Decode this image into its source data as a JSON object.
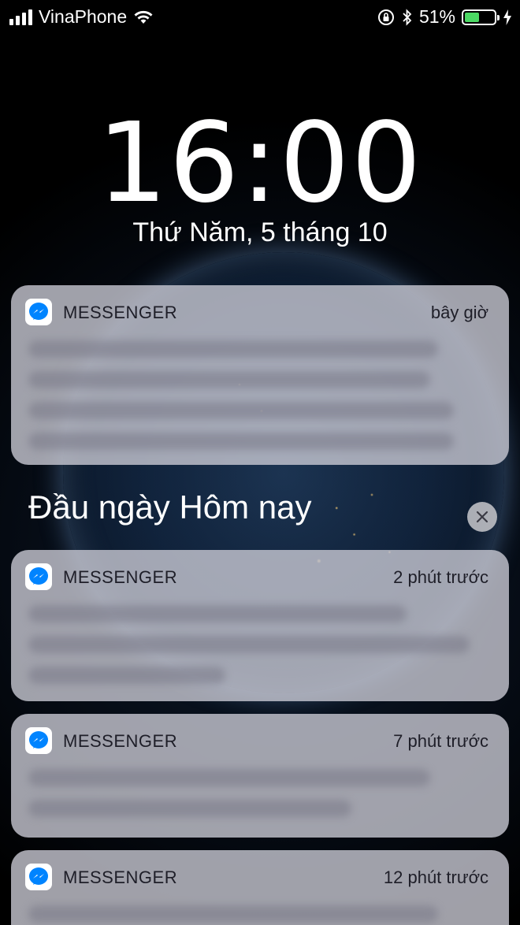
{
  "status_bar": {
    "carrier": "VinaPhone",
    "battery_percent": "51%",
    "battery_level": 0.51,
    "battery_color": "#4cd964",
    "icons": [
      "signal-bars-icon",
      "wifi-icon",
      "rotation-lock-icon",
      "bluetooth-icon",
      "battery-icon",
      "charging-bolt-icon"
    ]
  },
  "lock_screen": {
    "time": "16:00",
    "date": "Thứ Năm, 5 tháng 10"
  },
  "notifications": [
    {
      "app": "MESSENGER",
      "time": "bây giờ",
      "icon": "messenger-icon"
    },
    {
      "app": "MESSENGER",
      "time": "2 phút trước",
      "icon": "messenger-icon"
    },
    {
      "app": "MESSENGER",
      "time": "7 phút trước",
      "icon": "messenger-icon"
    },
    {
      "app": "MESSENGER",
      "time": "12 phút trước",
      "icon": "messenger-icon"
    }
  ],
  "section": {
    "title": "Đầu ngày Hôm nay",
    "clear_icon": "close-icon"
  },
  "colors": {
    "messenger_blue": "#0084ff"
  }
}
